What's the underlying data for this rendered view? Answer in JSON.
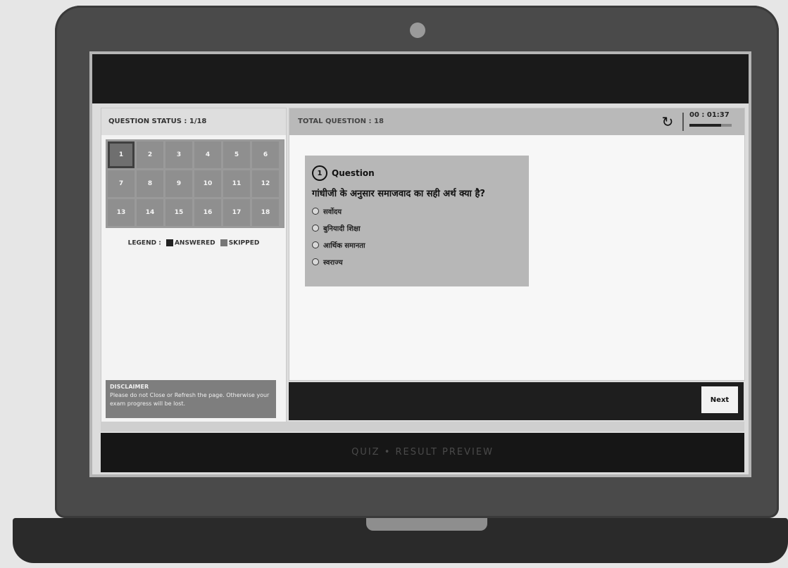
{
  "left_panel": {
    "status_label": "QUESTION STATUS : 1/18",
    "questions": [
      "1",
      "2",
      "3",
      "4",
      "5",
      "6",
      "7",
      "8",
      "9",
      "10",
      "11",
      "12",
      "13",
      "14",
      "15",
      "16",
      "17",
      "18"
    ],
    "current_question": 1,
    "legend": {
      "label": "LEGEND :",
      "answered": "ANSWERED",
      "skipped": "SKIPPED"
    },
    "disclaimer": {
      "title": "DISCLAIMER",
      "text": "Please do not Close or Refresh the page. Otherwise your exam progress will be lost."
    }
  },
  "main": {
    "total_questions_label": "TOTAL QUESTION : 18",
    "timer": "00 : 01:37",
    "timer_progress": 0.75,
    "question": {
      "number": "1",
      "heading": "Question",
      "text": "गांधीजी के अनुसार समाजवाद का सही अर्थ क्या है?",
      "options": [
        "सर्वोदय",
        "बुनियादी शिक्षा",
        "आर्थिक समानता",
        "स्वराज्य"
      ]
    },
    "next_label": "Next"
  },
  "footer": {
    "text": "QUIZ • RESULT PREVIEW"
  },
  "colors": {
    "answered": "#222222",
    "skipped": "#777777"
  }
}
